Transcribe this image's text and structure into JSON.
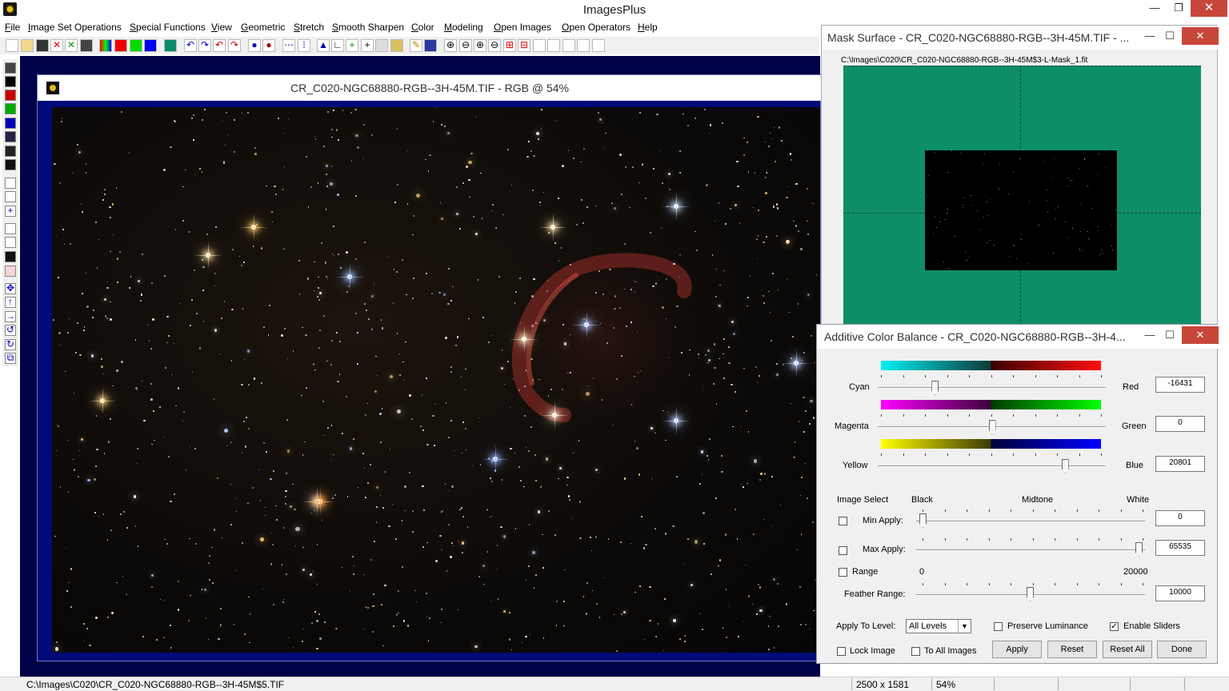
{
  "app": {
    "title": "ImagesPlus",
    "controls": {
      "minimize": "—",
      "maximize": "❐",
      "close": "✕"
    }
  },
  "menu": [
    "File",
    "Image Set Operations",
    "Special Functions",
    "View",
    "Geometric",
    "Stretch",
    "Smooth Sharpen",
    "Color",
    "Modeling",
    "Open Images",
    "Open Operators",
    "Help"
  ],
  "image_window": {
    "title": "CR_C020-NGC68880-RGB--3H-45M.TIF - RGB @ 54%"
  },
  "mask_surface": {
    "title": "Mask Surface - CR_C020-NGC68880-RGB--3H-45M.TIF - ...",
    "path": "C:\\Images\\C020\\CR_C020-NGC68880-RGB--3H-45M$3-L-Mask_1.fit",
    "controls": {
      "minimize": "—",
      "maximize": "☐",
      "close": "✕"
    }
  },
  "color_balance": {
    "title": "Additive Color Balance - CR_C020-NGC68880-RGB--3H-4...",
    "controls": {
      "minimize": "—",
      "maximize": "☐",
      "close": "✕"
    },
    "sliders": [
      {
        "left_label": "Cyan",
        "right_label": "Red",
        "value": "-16431",
        "colors": [
          "#00e5e5",
          "#ff1a1a"
        ],
        "mid": "#1d1d1d",
        "position": 0.25
      },
      {
        "left_label": "Magenta",
        "right_label": "Green",
        "value": "0",
        "colors": [
          "#ff00ff",
          "#00ff00"
        ],
        "mid": "#1d1d1d",
        "position": 0.5
      },
      {
        "left_label": "Yellow",
        "right_label": "Blue",
        "value": "20801",
        "colors": [
          "#ffff00",
          "#0000ff"
        ],
        "mid": "#1d1d1d",
        "position": 0.82
      }
    ],
    "image_select": {
      "label": "Image Select",
      "black": "Black",
      "midtone": "Midtone",
      "white": "White",
      "min_apply": {
        "label": "Min Apply:",
        "value": "0",
        "checked": false
      },
      "max_apply": {
        "label": "Max Apply:",
        "value": "65535",
        "checked": false
      },
      "range": {
        "label": "Range",
        "min": "0",
        "max": "20000",
        "checked": false
      },
      "feather_range": {
        "label": "Feather Range:",
        "value": "10000"
      }
    },
    "apply_to_level": {
      "label": "Apply To Level:",
      "selected": "All Levels"
    },
    "preserve_luminance": {
      "label": "Preserve Luminance",
      "checked": false
    },
    "enable_sliders": {
      "label": "Enable Sliders",
      "checked": true
    },
    "lock_image": {
      "label": "Lock Image",
      "checked": false
    },
    "to_all_images": {
      "label": "To All Images",
      "checked": false
    },
    "buttons": {
      "apply": "Apply",
      "reset": "Reset",
      "reset_all": "Reset All",
      "done": "Done"
    }
  },
  "status": {
    "path": "C:\\Images\\C020\\CR_C020-NGC68880-RGB--3H-45M$5.TIF",
    "dimensions": "2500 x 1581",
    "zoom": "54%"
  }
}
